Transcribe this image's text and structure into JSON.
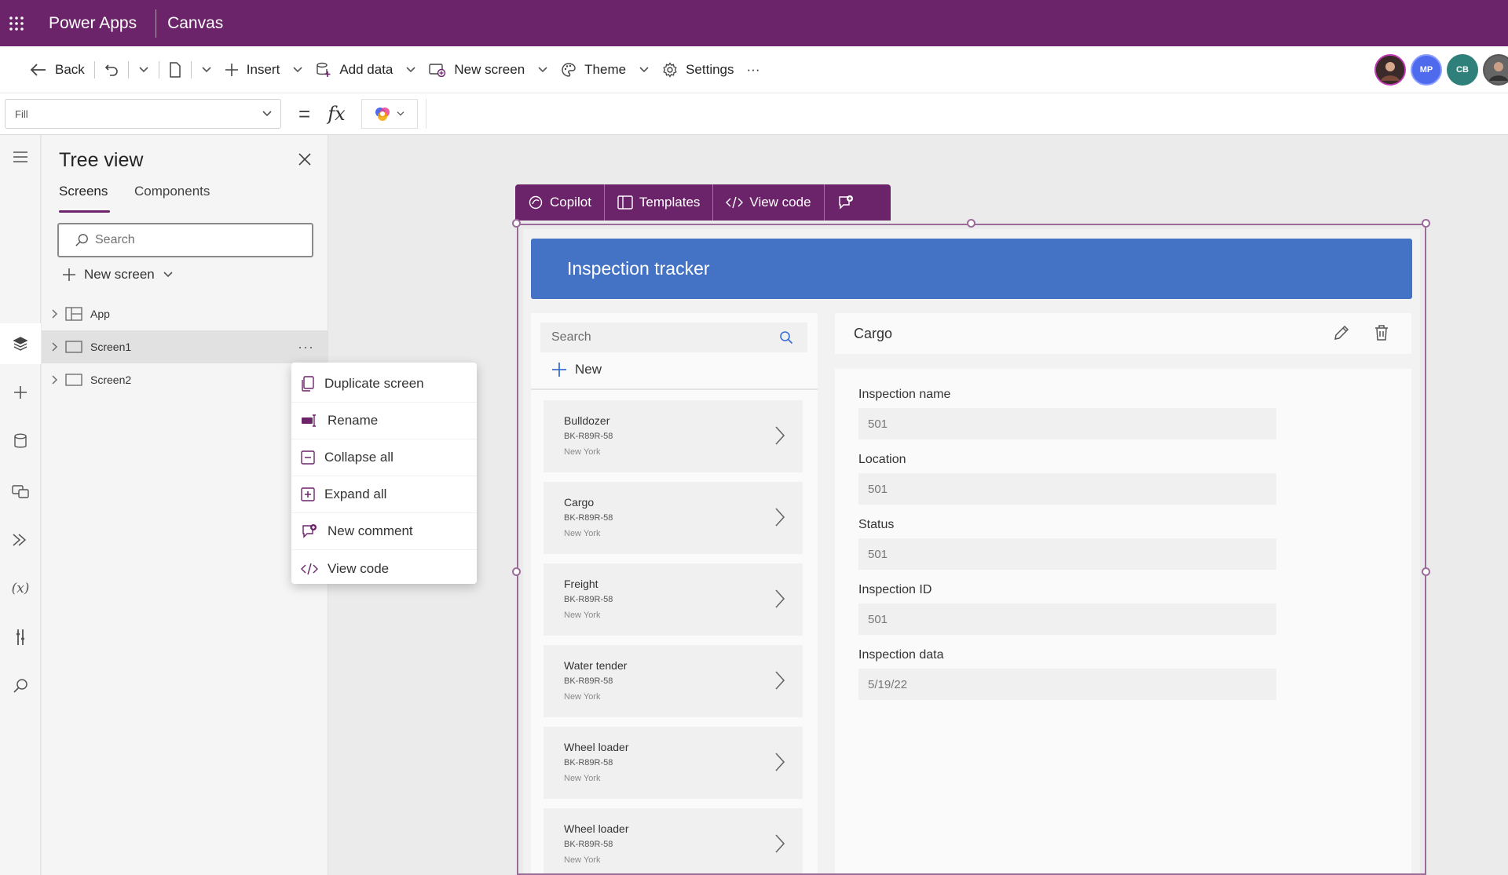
{
  "topbar": {
    "app_name": "Power Apps",
    "mode": "Canvas",
    "bg_color": "#6b2469"
  },
  "commandbar": {
    "back": "Back",
    "insert": "Insert",
    "add_data": "Add data",
    "new_screen": "New screen",
    "theme": "Theme",
    "settings": "Settings",
    "more": "···"
  },
  "avatars": [
    {
      "initials": "",
      "color": "#3a2a2a"
    },
    {
      "initials": "MP",
      "color": "#4f6bed"
    },
    {
      "initials": "CB",
      "color": "#2f7f7a"
    },
    {
      "initials": "",
      "color": "#555555"
    }
  ],
  "formula": {
    "property": "Fill",
    "value": ""
  },
  "tree": {
    "title": "Tree view",
    "tabs": [
      "Screens",
      "Components"
    ],
    "search_placeholder": "Search",
    "new_screen": "New screen",
    "items": [
      {
        "label": "App"
      },
      {
        "label": "Screen1"
      },
      {
        "label": "Screen2"
      }
    ]
  },
  "context_menu": {
    "items": [
      "Duplicate screen",
      "Rename",
      "Collapse all",
      "Expand all",
      "New comment",
      "View code"
    ]
  },
  "canvas_toolbar": {
    "copilot": "Copilot",
    "templates": "Templates",
    "view_code": "View code"
  },
  "app": {
    "header": "Inspection tracker",
    "header_color": "#4472c4",
    "list_search_placeholder": "Search",
    "new_label": "New",
    "items": [
      {
        "title": "Bulldozer",
        "sub": "BK-R89R-58",
        "loc": "New York"
      },
      {
        "title": "Cargo",
        "sub": "BK-R89R-58",
        "loc": "New York"
      },
      {
        "title": "Freight",
        "sub": "BK-R89R-58",
        "loc": "New York"
      },
      {
        "title": "Water tender",
        "sub": "BK-R89R-58",
        "loc": "New York"
      },
      {
        "title": "Wheel loader",
        "sub": "BK-R89R-58",
        "loc": "New York"
      },
      {
        "title": "Wheel loader",
        "sub": "BK-R89R-58",
        "loc": "New York"
      }
    ],
    "detail": {
      "title": "Cargo",
      "fields": [
        {
          "label": "Inspection name",
          "value": "501"
        },
        {
          "label": "Location",
          "value": "501"
        },
        {
          "label": "Status",
          "value": "501"
        },
        {
          "label": "Inspection ID",
          "value": "501"
        },
        {
          "label": "Inspection data",
          "value": "5/19/22"
        }
      ]
    }
  }
}
